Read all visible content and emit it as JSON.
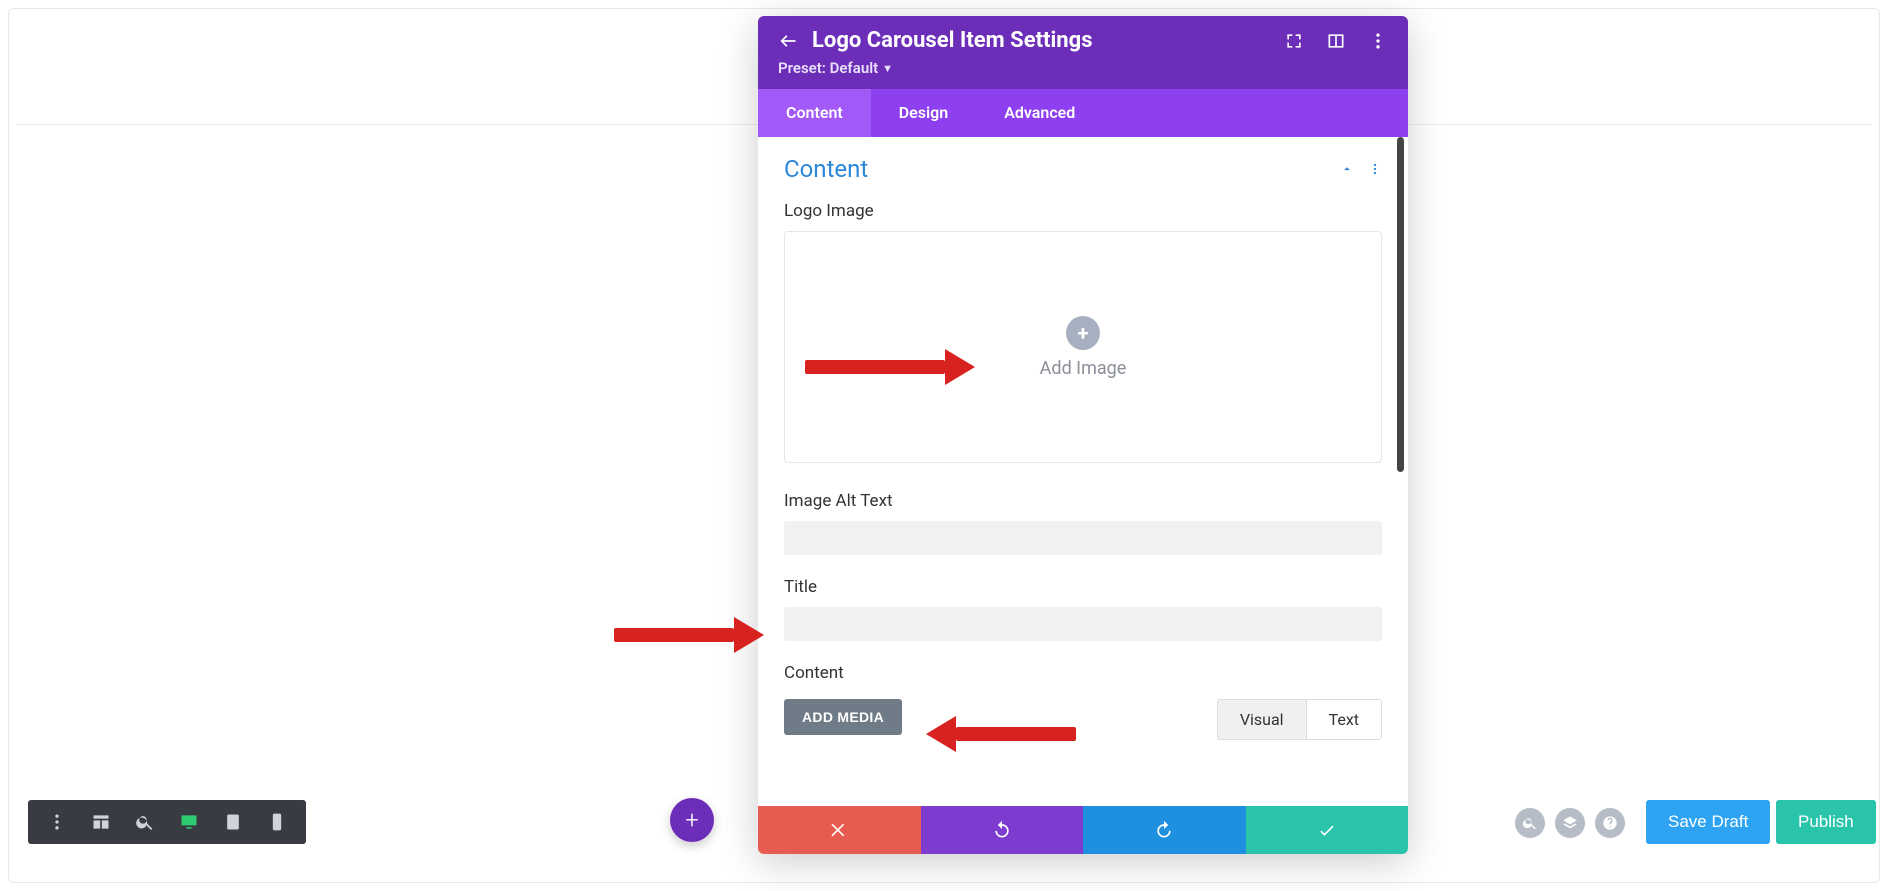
{
  "modal": {
    "title": "Logo Carousel Item Settings",
    "preset_label": "Preset: Default",
    "tabs": [
      "Content",
      "Design",
      "Advanced"
    ],
    "active_tab": 0,
    "section_title": "Content",
    "fields": {
      "logo_image_label": "Logo Image",
      "add_image_label": "Add Image",
      "image_alt_label": "Image Alt Text",
      "image_alt_value": "",
      "title_label": "Title",
      "title_value": "",
      "content_label": "Content",
      "add_media_label": "ADD MEDIA",
      "editor_tabs": [
        "Visual",
        "Text"
      ],
      "editor_active_tab": 0
    }
  },
  "bottom_right": {
    "save_draft": "Save Draft",
    "publish": "Publish"
  },
  "colors": {
    "divi_purple": "#6c2eb9",
    "tab_purple": "#8e3ff0",
    "blue": "#2ea3f2",
    "teal": "#29c4a9",
    "red": "#e85b51"
  }
}
